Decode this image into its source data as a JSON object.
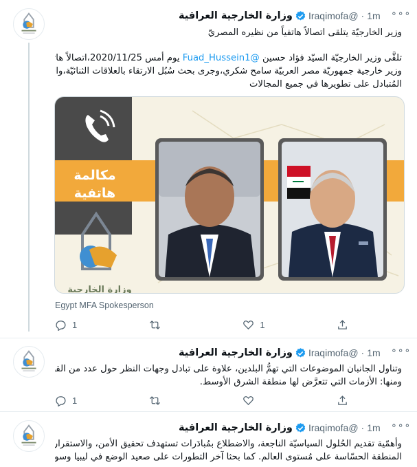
{
  "tweets": [
    {
      "author_name": "وزارة الخارجية العراقية",
      "handle": "@Iraqimofa",
      "separator": "·",
      "time": "1m",
      "more": "∘∘∘",
      "headline": "وزير الخارجيّة يتلقى اتصالاً هاتفياً من نظيره المصريّ",
      "body_line1_before": "تلقَّى وزير الخارجيّة السيّد فؤاد حسين",
      "body_mention": "@Fuad_Hussein1",
      "body_line1_after": " يوم أمس 2020/11/25،اتصالاً هاتفيّاً من",
      "body_line2": "وزير خارجية جمهوريّة مصر العربيّة سامح شكري،وجرى بحث سُبُل الارتقاء بالعلاقات الثنائيّة،والحرص",
      "body_line3": "المُتبادل على تطويرها في جميع المجالات",
      "media": {
        "call_label_1": "مكالمة",
        "call_label_2": "هاتفية",
        "ministry_logo_text": "وزارة الخارجية"
      },
      "media_caption": "Egypt MFA Spokesperson",
      "replies": "1",
      "retweets": "",
      "likes": "1"
    },
    {
      "author_name": "وزارة الخارجية العراقية",
      "handle": "@Iraqimofa",
      "separator": "·",
      "time": "1m",
      "more": "∘∘∘",
      "line1": "وتناول الجانبان الموضوعات التي تهمُّ البلدين، علاوة على تبادل وجهات النظر حول عدد من القضايا،",
      "line2": "ومنها: الأزمات التي تتعرَّض لها منطقة الشرق الأوسط.",
      "replies": "1",
      "retweets": "",
      "likes": ""
    },
    {
      "author_name": "وزارة الخارجية العراقية",
      "handle": "@Iraqimofa",
      "separator": "·",
      "time": "1m",
      "more": "∘∘∘",
      "line1": "وأهمّية تقديم الحُلول السياسيّة الناجعة، والاضطلاع بمُبادَرات تستهدف تحقيق الأمن، والاستقرار في هذه",
      "line2": "المنطقة الحسّاسة على مُستوى العالم. كما بحثا آخر التطورات على صعيد الوضع في ليبيا وسوريا."
    }
  ],
  "colors": {
    "accent": "#1d9bf0",
    "muted": "#536471",
    "banner_orange": "#f2a93b",
    "panel_dark": "#4a4a4a"
  },
  "icons": [
    "verified-badge-icon",
    "reply-icon",
    "retweet-icon",
    "like-icon",
    "share-icon",
    "phone-icon",
    "more-icon"
  ]
}
